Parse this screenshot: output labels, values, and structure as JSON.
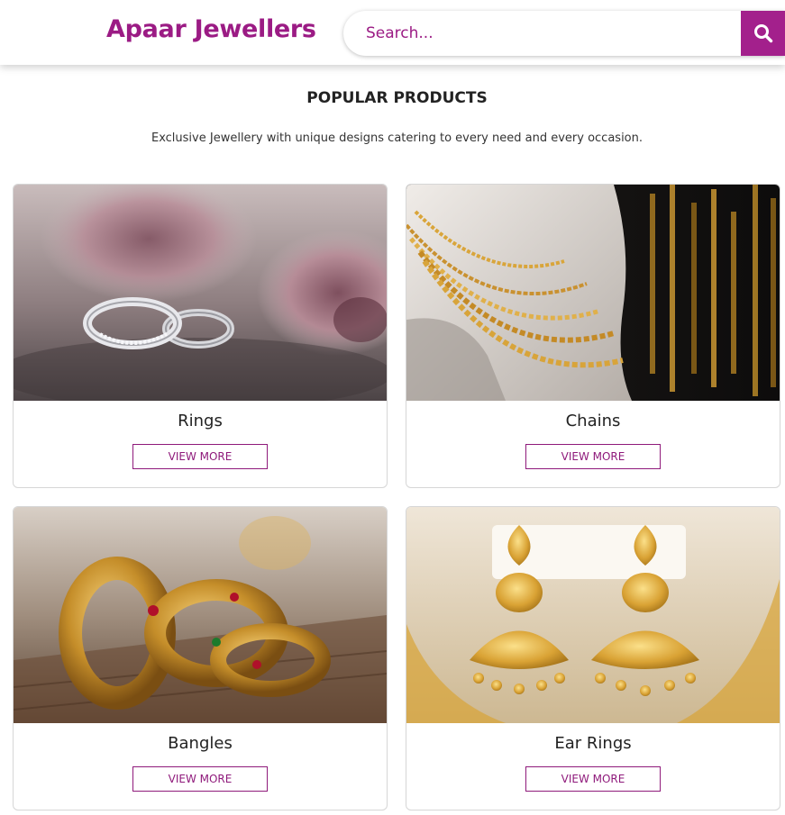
{
  "header": {
    "brand": "Apaar Jewellers",
    "search_placeholder": "Search...",
    "search_icon": "search-icon"
  },
  "section": {
    "title": "POPULAR PRODUCTS",
    "subtitle": "Exclusive Jewellery with unique designs catering to every need and every occasion."
  },
  "products": [
    {
      "name": "Rings",
      "button_label": "VIEW MORE"
    },
    {
      "name": "Chains",
      "button_label": "VIEW MORE"
    },
    {
      "name": "Bangles",
      "button_label": "VIEW MORE"
    },
    {
      "name": "Ear Rings",
      "button_label": "VIEW MORE"
    }
  ],
  "colors": {
    "brand": "#9b1b84",
    "search_button": "#a3208c",
    "button_border": "#8f1a7b"
  }
}
